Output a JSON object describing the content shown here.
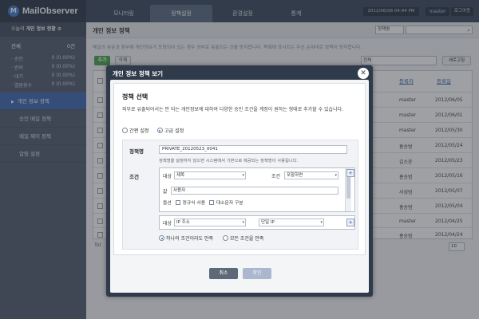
{
  "app": {
    "logo": "MailObserver",
    "logo_mark": "M"
  },
  "nav": {
    "tabs": [
      "모니터링",
      "정책설정",
      "환경설정",
      "통계"
    ],
    "datetime": "2012/06/08 04:44 PM",
    "user": "master",
    "logout": "로그아웃"
  },
  "sidebar": {
    "status_prefix": "오늘의 ",
    "status_bold": "개인 정보 현황",
    "total_label": "전체",
    "total_value": "0건",
    "stats": [
      {
        "label": "· 승인",
        "value": "0 (0.00%)"
      },
      {
        "label": "· 반려",
        "value": "0 (0.00%)"
      },
      {
        "label": "· 대기",
        "value": "0 (0.00%)"
      },
      {
        "label": "· 열람횟수",
        "value": "0 (0.00%)"
      }
    ],
    "menu": [
      "개인 정보 정책",
      "승인 메일 정책",
      "메일 제어 정책",
      "알림 설정"
    ]
  },
  "page": {
    "title": "개인 정보 정책",
    "search_field": "정책명",
    "description": "메일의 본문과 첨부에 개인정보가 포함되어 있는 경우 외부로 유출되는 것을 방지합니다. 목록에 표시되는 우선 순위대로 정책이 동작합니다.",
    "add": "추가",
    "delete": "삭제",
    "filter": "전체",
    "refresh": "새로고침",
    "total": "Tot",
    "page_size": "10"
  },
  "table": {
    "headers": [
      "등록자",
      "등록일"
    ],
    "rows": [
      {
        "registrant": "master",
        "date": "2012/06/05"
      },
      {
        "registrant": "master",
        "date": "2012/06/01"
      },
      {
        "registrant": "master",
        "date": "2012/05/30"
      },
      {
        "registrant": "홍승범",
        "date": "2012/05/24"
      },
      {
        "registrant": "김소윤",
        "date": "2012/05/23"
      },
      {
        "registrant": "홍승범",
        "date": "2012/05/16"
      },
      {
        "registrant": "서성범",
        "date": "2012/05/07"
      },
      {
        "registrant": "홍승범",
        "date": "2012/05/04"
      },
      {
        "registrant": "master",
        "date": "2012/04/25"
      },
      {
        "registrant": "홍승범",
        "date": "2012/04/24"
      }
    ]
  },
  "dialog": {
    "title": "개인 정보 정책 보기",
    "section_title": "정책 선택",
    "section_desc": "외부로 유출되어서는 안 되는 개인정보에 대하여 다양한 승인 조건을 계정이 원하는 형태로 추가할 수 있습니다.",
    "mode_simple": "간편 설정",
    "mode_advanced": "고급 설정",
    "policy_label": "정책명",
    "policy_value": "PRIVATE_20120523_0041",
    "policy_hint": "정책명을 설정하지 않으면 시스템에서 기본으로 제공되는 정책명이 사용됩니다.",
    "condition_label": "조건",
    "target_label": "대상",
    "target_value": "제목",
    "cond_label": "조건",
    "cond_value": "포함하면",
    "value_label": "값",
    "value_value": "사용자",
    "option_label": "옵션",
    "opt_regex": "정규식 사용",
    "opt_case": "대소문자 구분",
    "target2_label": "대상",
    "target2_value": "IP 주소",
    "target2_cond": "단일 IP",
    "match_any": "하나의 조건이라도 만족",
    "match_all": "모든 조건을 만족",
    "cancel": "취소",
    "ok": "확인"
  }
}
